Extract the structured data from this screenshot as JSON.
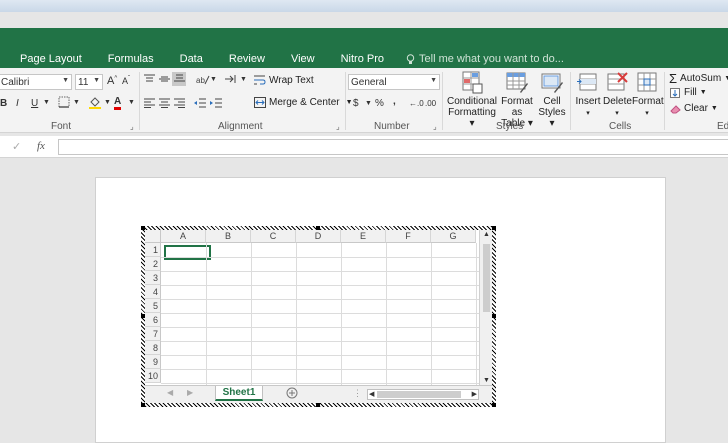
{
  "tabs": [
    "Page Layout",
    "Formulas",
    "Data",
    "Review",
    "View",
    "Nitro Pro"
  ],
  "tell_me": "Tell me what you want to do...",
  "ribbon": {
    "font": {
      "name": "Calibri",
      "size": "11",
      "grow": "A",
      "shrink": "A",
      "bold": "B",
      "italic": "I",
      "underline": "U",
      "font_color": "A",
      "group": "Font"
    },
    "alignment": {
      "wrap_text": "Wrap Text",
      "merge_center": "Merge & Center",
      "group": "Alignment"
    },
    "number": {
      "format": "General",
      "currency": "$",
      "percent": "%",
      "comma": ",",
      "inc_decimal": "←.0",
      "dec_decimal": ".00",
      "group": "Number"
    },
    "styles": {
      "conditional": [
        "Conditional",
        "Formatting ▾"
      ],
      "format_table": [
        "Format as",
        "Table ▾"
      ],
      "cell_styles": [
        "Cell",
        "Styles ▾"
      ],
      "group": "Styles"
    },
    "cells": {
      "insert": "Insert",
      "delete": "Delete",
      "format": "Format",
      "group": "Cells"
    },
    "editing": {
      "autosum": "AutoSum",
      "fill": "Fill",
      "clear": "Clear",
      "group": "Edi"
    }
  },
  "formula_bar": {
    "check": "✓",
    "fx": "fx",
    "value": ""
  },
  "sheet": {
    "columns": [
      "A",
      "B",
      "C",
      "D",
      "E",
      "F",
      "G"
    ],
    "rows": [
      "1",
      "2",
      "3",
      "4",
      "5",
      "6",
      "7",
      "8",
      "9",
      "10"
    ],
    "active_tab": "Sheet1"
  },
  "colors": {
    "accent": "#217346"
  }
}
